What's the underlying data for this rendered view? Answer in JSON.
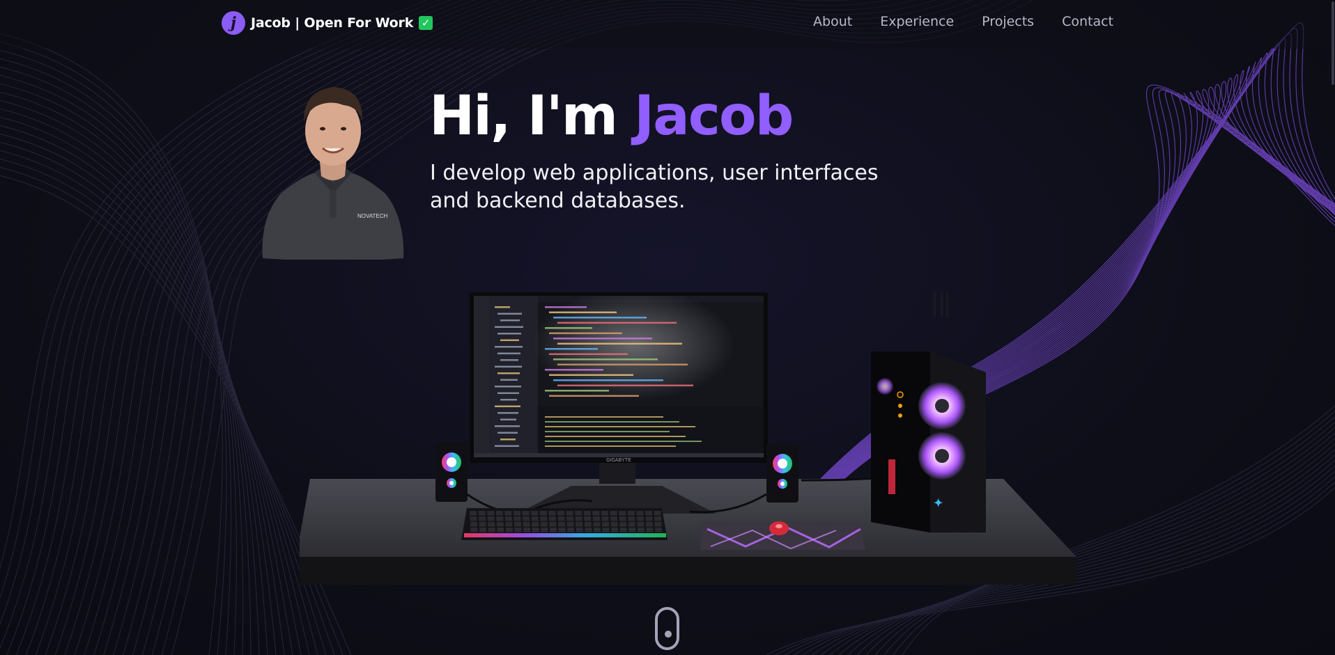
{
  "brand": {
    "logo_letter": "j",
    "name": "Jacob | Open For Work",
    "check": "✓"
  },
  "nav": {
    "items": [
      {
        "label": "About"
      },
      {
        "label": "Experience"
      },
      {
        "label": "Projects"
      },
      {
        "label": "Contact"
      }
    ]
  },
  "hero": {
    "title_prefix": "Hi, I'm ",
    "title_name": "Jacob",
    "subtitle_line1": "I develop web applications, user interfaces",
    "subtitle_line2": "and backend databases."
  },
  "scene": {
    "monitor_brand": "GIGABYTE",
    "shirt_logo": "NOVATECH"
  },
  "colors": {
    "accent": "#915eff",
    "background": "#0f0f19",
    "check_green": "#22c55e"
  },
  "icons": [
    "logo-icon",
    "check-icon",
    "scroll-mouse-icon"
  ]
}
